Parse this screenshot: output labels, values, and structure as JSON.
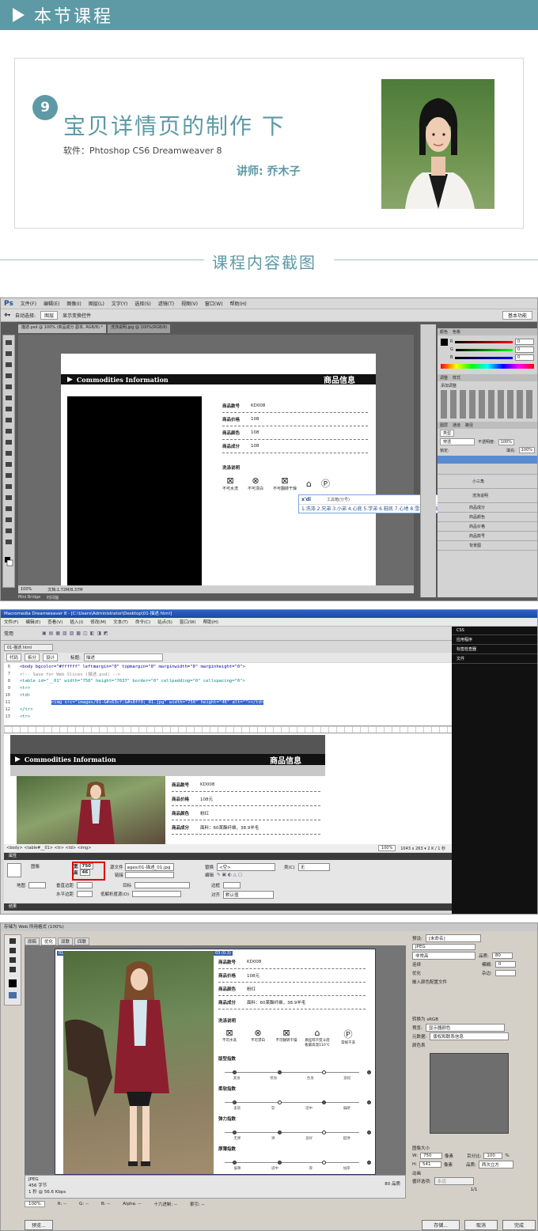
{
  "header": {
    "title": "本节课程"
  },
  "card": {
    "number": "9",
    "title": "宝贝详情页的制作 下",
    "software": "软件：Phtoshop CS6  Dreamweaver 8",
    "teacher": "讲师:  乔木子"
  },
  "section": {
    "title": "课程内容截图"
  },
  "ps": {
    "logo": "Ps",
    "menu": [
      "文件(F)",
      "编辑(E)",
      "图像(I)",
      "图层(L)",
      "文字(Y)",
      "选择(S)",
      "滤镜(T)",
      "视图(V)",
      "窗口(W)",
      "帮助(H)"
    ],
    "options": [
      "自动选择:",
      "图层",
      "显示变换控件"
    ],
    "workspace": "基本功能",
    "tabs": [
      "描述.psd @ 100% (商品成分 副本, RGB/8) *",
      "洗涤说明.jpg @ 100%(RGB/8)"
    ],
    "banner_en": "Commodities Information",
    "banner_cn": "商品信息",
    "fields": [
      {
        "label": "商品款号",
        "value": "KD008"
      },
      {
        "label": "商品价格",
        "value": "108"
      },
      {
        "label": "商品颜色",
        "value": "108"
      },
      {
        "label": "商品成分",
        "value": "108"
      }
    ],
    "wash_title": "洗涤说明",
    "wash": [
      "不可水洗",
      "不可漂白",
      "不可翻转干燥",
      "",
      ""
    ],
    "ime_input": "x'di",
    "ime_hint": "工具箱(分号)",
    "ime_candidates": "1.洗涤 2.兄弟 3.小弟 4.心底 5.学弟 6.鞋底 7.心地 8.雪地 9.新纸",
    "zoom": "100%",
    "docsize": "文档:1.72M/8.37M",
    "bridge": "Mini Bridge",
    "timeline": "时间轴",
    "panels": {
      "color_tab": "颜色",
      "swatch_tab": "色板",
      "adjust_tab": "调整",
      "style_tab": "样式",
      "add_adjust": "添加调整",
      "layers_tab": "图层",
      "channels_tab": "通道",
      "paths_tab": "路径",
      "kind": "类型",
      "blend": "穿透",
      "opacity_label": "不透明度:",
      "opacity": "100%",
      "fill_label": "填充:",
      "fill": "100%",
      "lock": "锁定:"
    },
    "layers": [
      "小三角",
      "洗涤说明",
      "商品成分",
      "商品颜色",
      "商品价格",
      "商品款号",
      "背景图"
    ],
    "rgb": [
      "R",
      "G",
      "B"
    ],
    "rgbval": [
      "0",
      "0",
      "0"
    ]
  },
  "dw": {
    "title": "Macromedia Dreamweaver 8 - [C:\\Users\\Administrator\\Desktop\\01-描述.html]",
    "menu": [
      "文件(F)",
      "编辑(E)",
      "查看(V)",
      "插入(I)",
      "修改(M)",
      "文本(T)",
      "命令(C)",
      "站点(S)",
      "窗口(W)",
      "帮助(H)"
    ],
    "category": "常用",
    "doctab": "01-描述.html",
    "views": [
      "代码",
      "拆分",
      "设计"
    ],
    "title_label": "标题:",
    "title_value": "描述",
    "code": [
      {
        "n": "6",
        "t": "<body bgcolor=\"#ffffff\" leftmargin=\"0\" topmargin=\"0\" marginwidth=\"0\" marginheight=\"0\">"
      },
      {
        "n": "7",
        "t": "<!-- Save for Web Slices (描述.psd) -->"
      },
      {
        "n": "8",
        "t": "<table id=\"__01\" width=\"750\" height=\"7637\" border=\"0\" cellpadding=\"0\" cellspacing=\"0\">"
      },
      {
        "n": "9",
        "t": "    <tr>"
      },
      {
        "n": "10",
        "t": "        <td>"
      },
      {
        "n": "11",
        "t": "<img src=\"images/01-&#x63cf;&#x8ff0;_01.jpg\" width=\"750\" height=\"46\" alt=\"\"></td>"
      },
      {
        "n": "12",
        "t": "    </tr>"
      },
      {
        "n": "13",
        "t": "    <tr>"
      }
    ],
    "panels": [
      "CSS",
      "应用程序",
      "标签检查器",
      "文件"
    ],
    "banner_en": "Commodities Information",
    "banner_cn": "商品信息",
    "fields": [
      {
        "label": "商品款号",
        "value": "KD008"
      },
      {
        "label": "商品价格",
        "value": "108元"
      },
      {
        "label": "商品颜色",
        "value": "粉红"
      },
      {
        "label": "商品成分",
        "value": "面料：60莱酯纤维，38.9羊毛"
      }
    ],
    "status_tags": "<body> <table#__01> <tr> <td> <img>",
    "status_info": "1043 x 263 ▾ 2 K / 1 秒",
    "zoom": "100%",
    "props_title": "属性",
    "image_label": "图像",
    "w_label": "宽",
    "w": "750",
    "h_label": "高",
    "h": "46",
    "src_label": "源文件",
    "src": "ages/01-描述_01.jpg",
    "link_label": "链接",
    "alt_label": "替换",
    "alt": "<空>",
    "edit_label": "编辑",
    "class_label": "类(C)",
    "class_value": "无",
    "map_label": "地图",
    "vspace": "垂直边距",
    "hspace": "水平边距",
    "target": "目标",
    "lowsrc": "低解析度源(O)",
    "border": "边框",
    "align": "对齐",
    "align_value": "默认值",
    "results": "结果"
  },
  "sfw": {
    "title": "存储为 Web 所用格式 (100%)",
    "tabs": [
      "原稿",
      "优化",
      "双联",
      "四联"
    ],
    "slice_tag": "01 (0.3)",
    "slice_tag2": "03 (0.3)",
    "fields": [
      {
        "label": "商品款号",
        "value": "KD008"
      },
      {
        "label": "商品价格",
        "value": "108元"
      },
      {
        "label": "商品颜色",
        "value": "粉红"
      },
      {
        "label": "商品成分",
        "value": "面料：60莱酯纤维，38.9羊毛"
      }
    ],
    "wash_title": "洗涤说明",
    "wash": [
      "不可水洗",
      "不可漂白",
      "不可翻转干燥",
      "悬挂晾干熨斗底板最高温110℃",
      "常规干洗"
    ],
    "scales": [
      {
        "title": "版型指数",
        "labels": [
          "紧身",
          "修身",
          "合身",
          "宽松"
        ],
        "sel": 2
      },
      {
        "title": "柔软指数",
        "labels": [
          "柔软",
          "软",
          "适中",
          "偏硬"
        ],
        "sel": 1
      },
      {
        "title": "弹力指数",
        "labels": [
          "无弹",
          "弹",
          "良好",
          "超弹"
        ],
        "sel": 2
      },
      {
        "title": "厚薄指数",
        "labels": [
          "偏薄",
          "适中",
          "厚",
          "加厚"
        ],
        "sel": 2
      }
    ],
    "footer_info": [
      "JPEG",
      "456 字节",
      "1 秒 @ 56.6 Kbps"
    ],
    "quality": "80 品质",
    "preset_label": "预设:",
    "preset": "[未命名]",
    "format": "JPEG",
    "compress": "非常高",
    "quality_label": "品质:",
    "quality_value": "80",
    "progressive": "连续",
    "blur_label": "模糊:",
    "blur_value": "0",
    "optimized": "优化",
    "matte": "杂边:",
    "embed": "嵌入颜色配置文件",
    "convert": "转换为 sRGB",
    "preview_label": "预览:",
    "preview": "显示器颜色",
    "meta_label": "元数据:",
    "meta": "版权和联系信息",
    "color_table": "颜色表",
    "image_size": "图像大小",
    "w_label": "W:",
    "w": "750",
    "h_label": "H:",
    "h": "541",
    "unit": "像素",
    "percent_label": "百分比:",
    "percent": "100",
    "pct": "%",
    "quality2_label": "品质:",
    "quality2": "两次立方",
    "anim": "动画",
    "loop_label": "循环选项:",
    "loop": "永远",
    "frame": "1/1",
    "zoom": "100%",
    "readout": [
      "R: --",
      "G: --",
      "B: --",
      "Alpha: --",
      "十六进制: --",
      "索引: --"
    ],
    "buttons": [
      "预览...",
      "存储...",
      "取消",
      "完成"
    ]
  }
}
